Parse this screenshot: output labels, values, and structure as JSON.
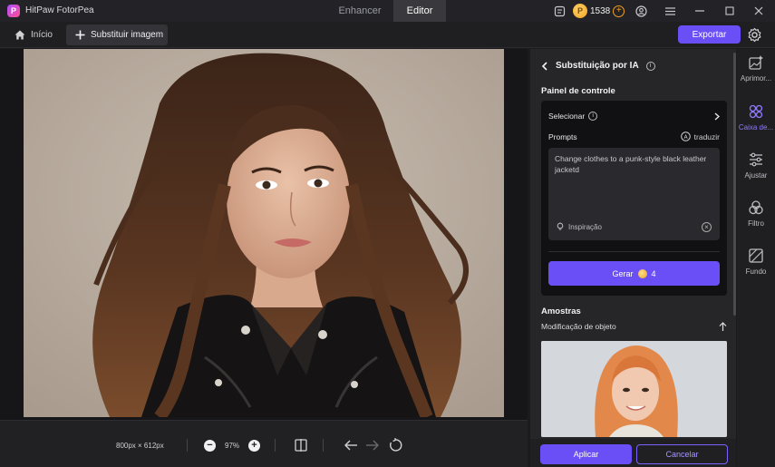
{
  "titlebar": {
    "app_name": "HitPaw FotorPea",
    "tabs": [
      "Enhancer",
      "Editor"
    ],
    "active_tab": "Editor",
    "credits": "1538"
  },
  "toolbar": {
    "home_label": "Início",
    "replace_label": "Substituir imagem",
    "export_label": "Exportar"
  },
  "canvas": {
    "dimensions": "800px × 612px",
    "zoom": "97%"
  },
  "panel": {
    "title": "Substituição por IA",
    "control_title": "Painel de controle",
    "select_label": "Selecionar",
    "prompts_label": "Prompts",
    "translate_label": "traduzir",
    "prompt_text": "Change clothes to a punk-style black leather jacketd",
    "inspiration_label": "Inspiração",
    "generate_label": "Gerar",
    "generate_cost": "4",
    "samples_title": "Amostras",
    "samples_subtitle": "Modificação de objeto",
    "apply_label": "Aplicar",
    "cancel_label": "Cancelar"
  },
  "sidenav": {
    "items": [
      {
        "label": "Aprimor...",
        "icon": "enhance-icon"
      },
      {
        "label": "Caixa de...",
        "icon": "toolbox-icon",
        "active": true
      },
      {
        "label": "Ajustar",
        "icon": "sliders-icon"
      },
      {
        "label": "Filtro",
        "icon": "filter-icon"
      },
      {
        "label": "Fundo",
        "icon": "background-icon"
      }
    ]
  },
  "colors": {
    "accent": "#6b4ff6",
    "active_nav": "#8f7bff"
  }
}
